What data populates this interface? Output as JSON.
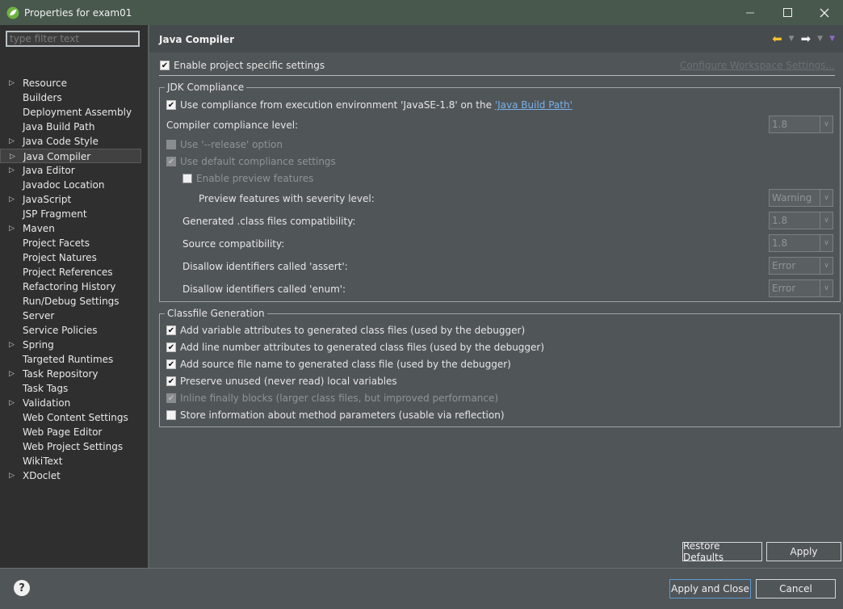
{
  "window": {
    "title": "Properties for exam01",
    "minimize": "—",
    "maximize": "☐",
    "close": "✕"
  },
  "sidebar": {
    "filter_placeholder": "type filter text",
    "items": [
      {
        "label": "Resource",
        "expandable": true
      },
      {
        "label": "Builders",
        "expandable": false
      },
      {
        "label": "Deployment Assembly",
        "expandable": false
      },
      {
        "label": "Java Build Path",
        "expandable": false
      },
      {
        "label": "Java Code Style",
        "expandable": true
      },
      {
        "label": "Java Compiler",
        "expandable": true,
        "selected": true
      },
      {
        "label": "Java Editor",
        "expandable": true
      },
      {
        "label": "Javadoc Location",
        "expandable": false
      },
      {
        "label": "JavaScript",
        "expandable": true
      },
      {
        "label": "JSP Fragment",
        "expandable": false
      },
      {
        "label": "Maven",
        "expandable": true
      },
      {
        "label": "Project Facets",
        "expandable": false
      },
      {
        "label": "Project Natures",
        "expandable": false
      },
      {
        "label": "Project References",
        "expandable": false
      },
      {
        "label": "Refactoring History",
        "expandable": false
      },
      {
        "label": "Run/Debug Settings",
        "expandable": false
      },
      {
        "label": "Server",
        "expandable": false
      },
      {
        "label": "Service Policies",
        "expandable": false
      },
      {
        "label": "Spring",
        "expandable": true
      },
      {
        "label": "Targeted Runtimes",
        "expandable": false
      },
      {
        "label": "Task Repository",
        "expandable": true
      },
      {
        "label": "Task Tags",
        "expandable": false
      },
      {
        "label": "Validation",
        "expandable": true
      },
      {
        "label": "Web Content Settings",
        "expandable": false
      },
      {
        "label": "Web Page Editor",
        "expandable": false
      },
      {
        "label": "Web Project Settings",
        "expandable": false
      },
      {
        "label": "WikiText",
        "expandable": false
      },
      {
        "label": "XDoclet",
        "expandable": true
      }
    ]
  },
  "header": {
    "title": "Java Compiler"
  },
  "settings": {
    "enable_project_specific": "Enable project specific settings",
    "configure_workspace": "Configure Workspace Settings..."
  },
  "jdk": {
    "group_label": "JDK Compliance",
    "use_compliance_prefix": "Use compliance from execution environment 'JavaSE-1.8' on the ",
    "use_compliance_link": "'Java Build Path'",
    "compliance_level_label": "Compiler compliance level:",
    "compliance_level_value": "1.8",
    "release_option": "Use '--release' option",
    "default_compliance": "Use default compliance settings",
    "enable_preview": "Enable preview features",
    "preview_severity_label": "Preview features with severity level:",
    "preview_severity_value": "Warning",
    "generated_compat_label": "Generated .class files compatibility:",
    "generated_compat_value": "1.8",
    "source_compat_label": "Source compatibility:",
    "source_compat_value": "1.8",
    "assert_label": "Disallow identifiers called 'assert':",
    "assert_value": "Error",
    "enum_label": "Disallow identifiers called 'enum':",
    "enum_value": "Error"
  },
  "classfile": {
    "group_label": "Classfile Generation",
    "options": [
      {
        "label": "Add variable attributes to generated class files (used by the debugger)",
        "checked": true,
        "enabled": true
      },
      {
        "label": "Add line number attributes to generated class files (used by the debugger)",
        "checked": true,
        "enabled": true
      },
      {
        "label": "Add source file name to generated class file (used by the debugger)",
        "checked": true,
        "enabled": true
      },
      {
        "label": "Preserve unused (never read) local variables",
        "checked": true,
        "enabled": true
      },
      {
        "label": "Inline finally blocks (larger class files, but improved performance)",
        "checked": true,
        "enabled": false
      },
      {
        "label": "Store information about method parameters (usable via reflection)",
        "checked": false,
        "enabled": true
      }
    ]
  },
  "buttons": {
    "restore_defaults": "Restore Defaults",
    "apply": "Apply",
    "apply_and_close": "Apply and Close",
    "cancel": "Cancel",
    "help": "?"
  },
  "colors": {
    "titlebar": "#48584d",
    "sidebar_bg": "#2f2f2f",
    "panel_bg": "#505558",
    "link": "#7ab1e8",
    "primary_border": "#5b9bd5"
  }
}
